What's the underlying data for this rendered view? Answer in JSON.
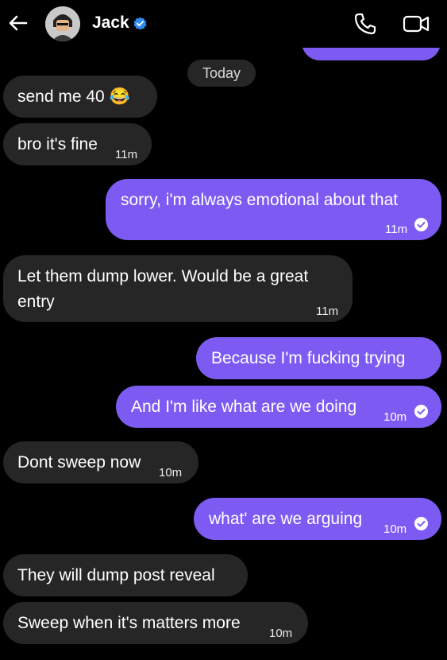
{
  "header": {
    "contact_name": "Jack",
    "icons": {
      "back": "arrow-left-icon",
      "verified": "verified-badge-icon",
      "call": "phone-icon",
      "video": "video-camera-icon"
    }
  },
  "colors": {
    "outgoing_bubble": "#7d5bf2",
    "incoming_bubble": "#262626",
    "background": "#000000",
    "verified": "#2e8bf0"
  },
  "date_separator": "Today",
  "messages": [
    {
      "direction": "in",
      "text": "send me 40 😂",
      "time": ""
    },
    {
      "direction": "in",
      "text": "bro it's fine",
      "time": "11m"
    },
    {
      "direction": "out",
      "text": "sorry, i'm always emotional about that",
      "time": "11m",
      "seen": true
    },
    {
      "direction": "in",
      "text_line1": "Let them dump lower. Would be a great",
      "text_line2": "entry",
      "time": "11m"
    },
    {
      "direction": "out",
      "text": "Because I'm fucking trying",
      "time": ""
    },
    {
      "direction": "out",
      "text": "And I'm like what are we doing",
      "time": "10m",
      "seen": true
    },
    {
      "direction": "in",
      "text": "Dont sweep now",
      "time": "10m"
    },
    {
      "direction": "out",
      "text": "what' are we arguing",
      "time": "10m",
      "seen": true
    },
    {
      "direction": "in",
      "text": "They will dump post reveal",
      "time": ""
    },
    {
      "direction": "in",
      "text": "Sweep when it's matters more",
      "time": "10m"
    }
  ]
}
